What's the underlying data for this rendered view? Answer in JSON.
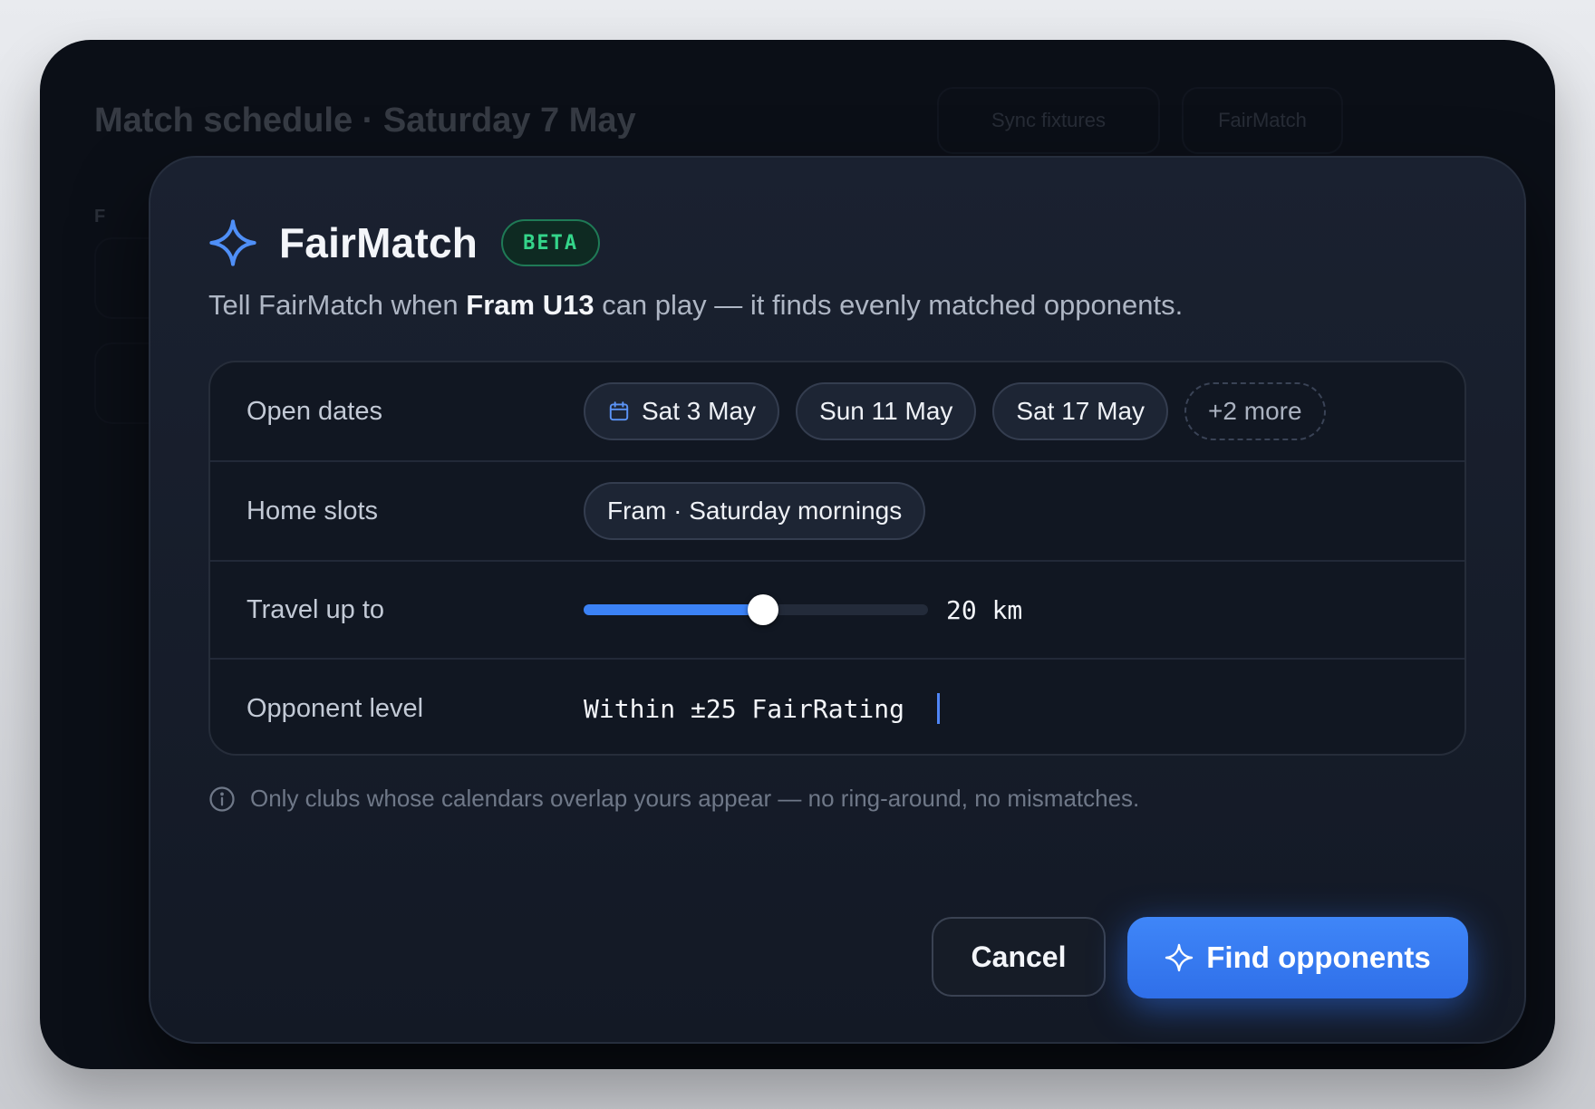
{
  "background": {
    "title": "Match schedule · Saturday 7 May",
    "sub": "F",
    "btn_sync": "Sync fixtures",
    "btn_fairmatch": "FairMatch"
  },
  "modal": {
    "title": "FairMatch",
    "badge": "BETA",
    "subtitle_pre": "Tell FairMatch when ",
    "subtitle_team": "Fram U13",
    "subtitle_post": " can play — it finds evenly matched opponents.",
    "rows": {
      "open_dates": {
        "label": "Open dates",
        "chips": [
          "Sat 3 May",
          "Sun 11 May",
          "Sat 17 May"
        ],
        "more": "+2 more"
      },
      "home_slots": {
        "label": "Home slots",
        "chip": "Fram · Saturday mornings"
      },
      "travel": {
        "label": "Travel up to",
        "value": "20 km",
        "fraction": 0.52
      },
      "level": {
        "label": "Opponent level",
        "value": "Within ±25 FairRating"
      }
    },
    "hint": "Only clubs whose calendars overlap yours appear — no ring-around, no mismatches.",
    "cancel_label": "Cancel",
    "primary_label": "Find opponents"
  },
  "colors": {
    "accent": "#3b82f6",
    "badge_green": "#34d58a",
    "modal_bg": "#171d2a"
  },
  "icons": {
    "title": "sparkle-icon",
    "date_chip": "calendar-icon",
    "hint": "info-icon",
    "primary": "sparkle-icon"
  }
}
